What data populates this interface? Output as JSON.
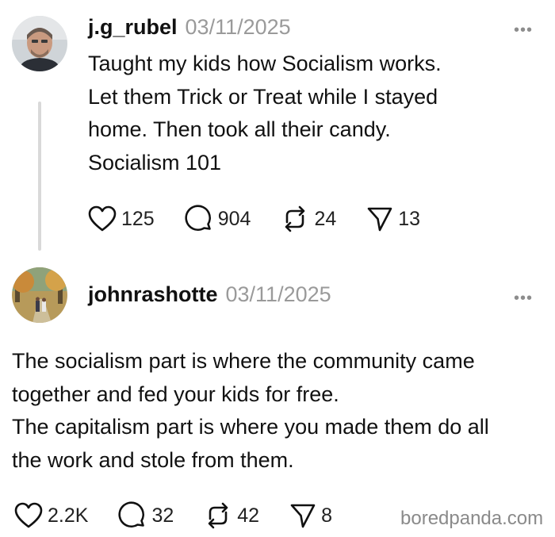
{
  "posts": [
    {
      "username": "j.g_rubel",
      "date": "03/11/2025",
      "more_label": "•••",
      "text": "Taught my kids how Socialism works.\nLet them Trick or Treat while I stayed\nhome. Then took all their candy.\nSocialism 101",
      "likes": "125",
      "replies": "904",
      "reposts": "24",
      "shares": "13",
      "avatar_icon": "person-photo-avatar"
    },
    {
      "username": "johnrashotte",
      "date": "03/11/2025",
      "more_label": "•••",
      "text": "The socialism part is where the community came\ntogether and fed your kids for free.\nThe capitalism part is where you made them do all\nthe work and stole from them.",
      "likes": "2.2K",
      "replies": "32",
      "reposts": "42",
      "shares": "8",
      "avatar_icon": "autumn-path-photo-avatar"
    }
  ],
  "watermark": "boredpanda.com",
  "colors": {
    "text": "#111111",
    "muted": "#9a9a9a",
    "line": "#d9d9d9"
  }
}
